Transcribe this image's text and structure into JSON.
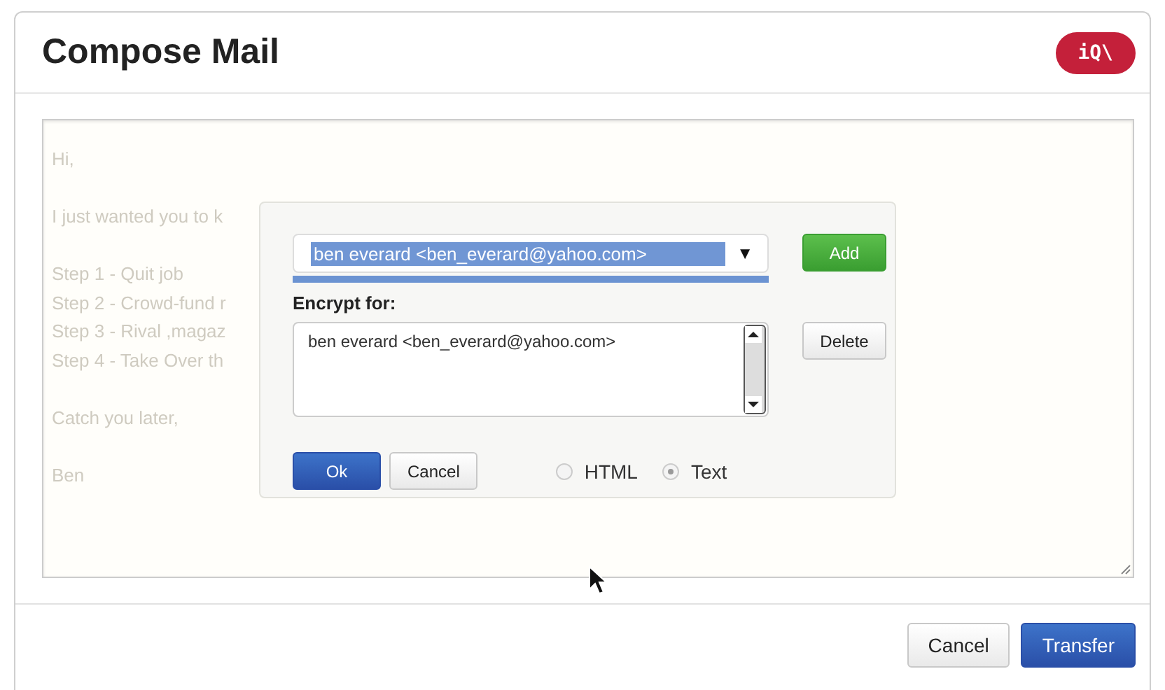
{
  "window": {
    "title": "Compose Mail",
    "badge": "iQ\\"
  },
  "message": {
    "paragraphs": [
      [
        "Hi,"
      ],
      [
        "I just wanted you to k"
      ],
      [
        "Step 1 - Quit job",
        "Step 2 - Crowd-fund r",
        "Step 3 - Rival ,magaz",
        "Step 4 - Take Over th"
      ],
      [
        "Catch you later,"
      ],
      [
        "Ben"
      ]
    ]
  },
  "dialog": {
    "recipient": {
      "value": "ben everard <ben_everard@yahoo.com>",
      "arrow": "▼"
    },
    "add_button": "Add",
    "encrypt_label": "Encrypt for:",
    "recipients": [
      "ben everard <ben_everard@yahoo.com>"
    ],
    "delete_button": "Delete",
    "ok_button": "Ok",
    "cancel_button": "Cancel",
    "formats": [
      {
        "label": "HTML",
        "selected": false
      },
      {
        "label": "Text",
        "selected": true
      }
    ]
  },
  "footer": {
    "buttons": [
      {
        "label": "Cancel",
        "kind": "default"
      },
      {
        "label": "Transfer",
        "kind": "primary"
      }
    ]
  }
}
